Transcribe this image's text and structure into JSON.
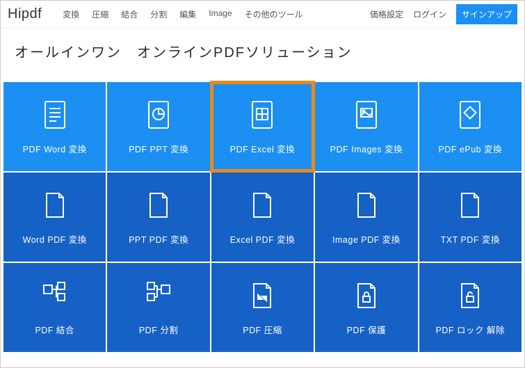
{
  "header": {
    "logo": "Hipdf",
    "nav": [
      "変換",
      "圧縮",
      "結合",
      "分割",
      "編集",
      "Image",
      "その他のツール"
    ],
    "right": {
      "pricing": "価格設定",
      "login": "ログイン",
      "signup": "サインアップ"
    }
  },
  "hero": {
    "title": "オールインワン　オンラインPDFソリューション"
  },
  "grid": {
    "rows": [
      [
        {
          "icon": "doc-lines",
          "label": "PDF Word 変換"
        },
        {
          "icon": "doc-pie",
          "label": "PDF PPT 変換"
        },
        {
          "icon": "doc-grid",
          "label": "PDF Excel 変換",
          "highlighted": true
        },
        {
          "icon": "doc-image",
          "label": "PDF Images 変換"
        },
        {
          "icon": "doc-epub",
          "label": "PDF ePub 変換"
        }
      ],
      [
        {
          "icon": "sheet-fold",
          "label": "Word PDF 変換"
        },
        {
          "icon": "sheet-fold",
          "label": "PPT PDF 変換"
        },
        {
          "icon": "sheet-fold",
          "label": "Excel PDF 変換"
        },
        {
          "icon": "sheet-fold",
          "label": "Image PDF 変換"
        },
        {
          "icon": "sheet-fold",
          "label": "TXT PDF 変換"
        }
      ],
      [
        {
          "icon": "merge",
          "label": "PDF 結合"
        },
        {
          "icon": "split",
          "label": "PDF 分割"
        },
        {
          "icon": "compress",
          "label": "PDF 圧縮"
        },
        {
          "icon": "lock",
          "label": "PDF 保護"
        },
        {
          "icon": "unlock",
          "label": "PDF ロック 解除"
        }
      ]
    ]
  }
}
